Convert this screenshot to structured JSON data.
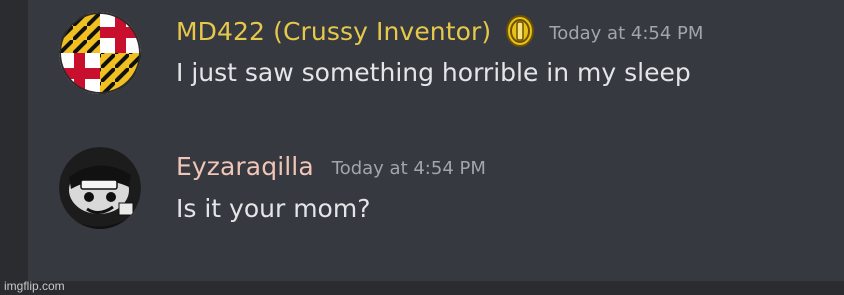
{
  "messages": [
    {
      "username": "MD422 (Crussy Inventor)",
      "timestamp": "Today at 4:54 PM",
      "content": "I just saw something horrible in my sleep",
      "username_color": "#e6c84a",
      "avatar_icon": "maryland-flag-avatar",
      "badge_icon": "gold-coin-icon"
    },
    {
      "username": "Eyzaraqilla",
      "timestamp": "Today at 4:54 PM",
      "content": "Is it your mom?",
      "username_color": "#f0c5b8",
      "avatar_icon": "monochrome-character-avatar"
    }
  ],
  "watermark": "imgflip.com",
  "colors": {
    "background": "#36393f",
    "message_text": "#e3e5e8",
    "timestamp_text": "#a2a5ab"
  }
}
